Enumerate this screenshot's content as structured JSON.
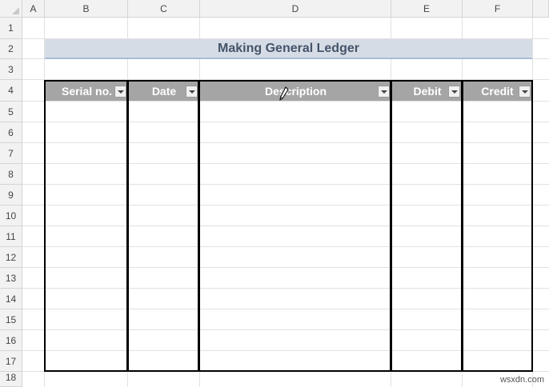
{
  "columns": [
    "A",
    "B",
    "C",
    "D",
    "E",
    "F"
  ],
  "rows": [
    "1",
    "2",
    "3",
    "4",
    "5",
    "6",
    "7",
    "8",
    "9",
    "10",
    "11",
    "12",
    "13",
    "14",
    "15",
    "16",
    "17",
    "18"
  ],
  "title": "Making General Ledger",
  "table": {
    "headers": [
      "Serial no.",
      "Date",
      "Description",
      "Debit",
      "Credit"
    ],
    "header_bg": "#a5a5a5",
    "header_fg": "#ffffff"
  },
  "title_style": {
    "bg": "#d6dce5",
    "fg": "#44546a",
    "underline": "#a9bcd9"
  },
  "watermark": "wsxdn.com"
}
